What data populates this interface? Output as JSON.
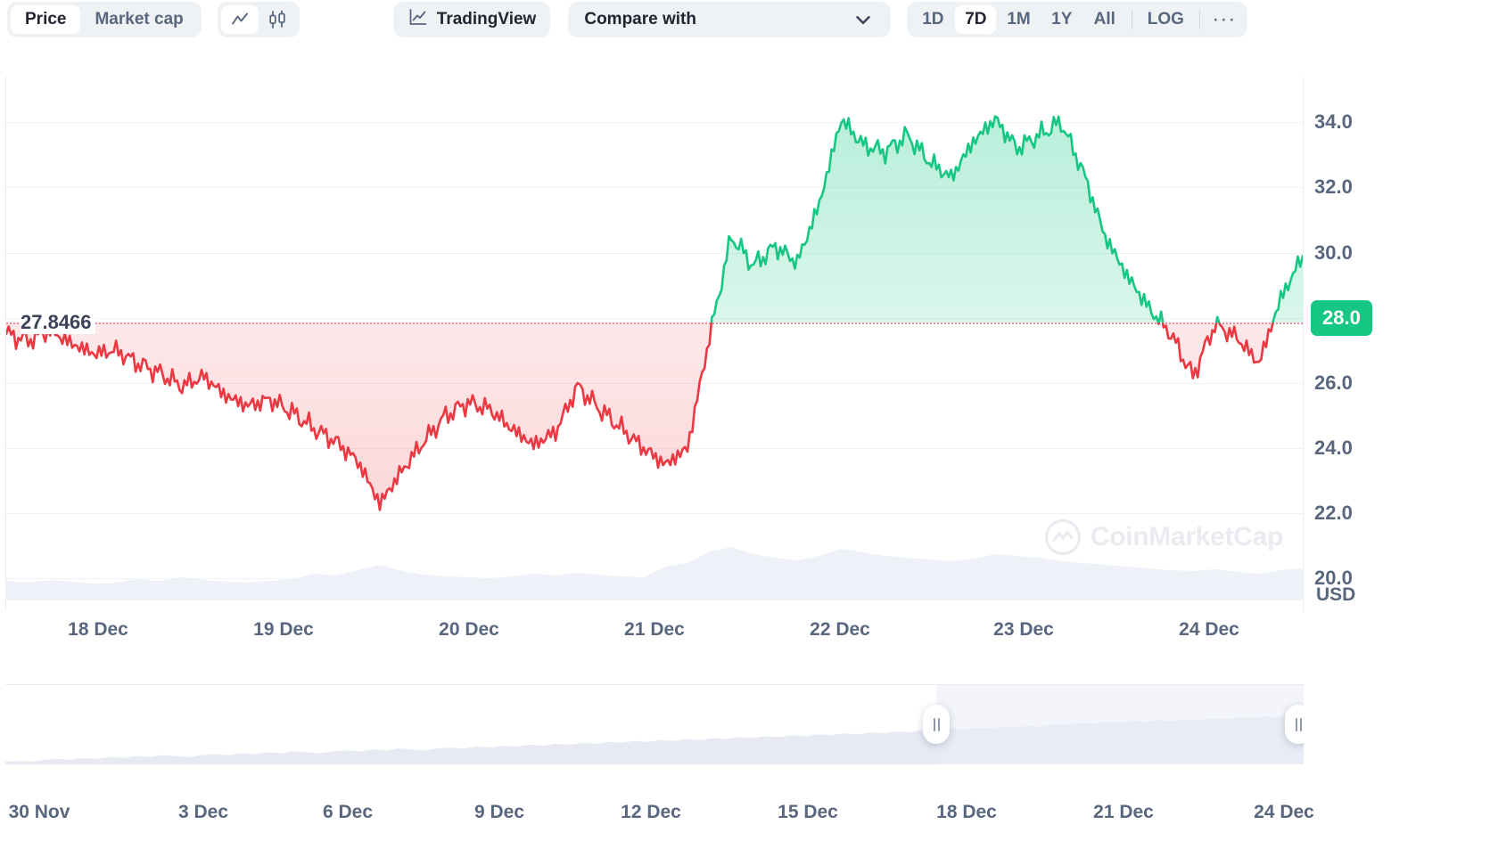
{
  "toolbar": {
    "metric_tabs": [
      {
        "label": "Price",
        "active": true
      },
      {
        "label": "Market cap",
        "active": false
      }
    ],
    "chart_type_icons": [
      {
        "name": "line-chart-icon",
        "active": true
      },
      {
        "name": "candlestick-chart-icon",
        "active": false
      }
    ],
    "tradingview_label": "TradingView",
    "compare_label": "Compare with",
    "range_buttons": [
      {
        "label": "1D",
        "active": false
      },
      {
        "label": "7D",
        "active": true
      },
      {
        "label": "1M",
        "active": false
      },
      {
        "label": "1Y",
        "active": false
      },
      {
        "label": "All",
        "active": false
      }
    ],
    "log_label": "LOG",
    "more_label": "···"
  },
  "chart_data": {
    "type": "area",
    "title": "",
    "xlabel": "",
    "ylabel": "USD",
    "currency_label": "USD",
    "ylim": [
      19.0,
      35.4
    ],
    "yticks": [
      "34.0",
      "32.0",
      "30.0",
      "28.0",
      "26.0",
      "24.0",
      "22.0",
      "20.0"
    ],
    "ytick_values": [
      34.0,
      32.0,
      30.0,
      28.0,
      26.0,
      24.0,
      22.0,
      20.0
    ],
    "current_price_label": "28.0",
    "current_price_value": 28.0,
    "reference_price_label": "27.8466",
    "reference_price_value": 27.8466,
    "grid": true,
    "legend": "none",
    "up_color": "#16c784",
    "down_color": "#ea3943",
    "xticks": [
      "18 Dec",
      "19 Dec",
      "20 Dec",
      "21 Dec",
      "22 Dec",
      "23 Dec",
      "24 Dec"
    ],
    "x": [
      "17 Dec 12:00",
      "17 Dec 14:00",
      "17 Dec 16:00",
      "17 Dec 18:00",
      "17 Dec 20:00",
      "17 Dec 22:00",
      "18 Dec 00:00",
      "18 Dec 03:00",
      "18 Dec 06:00",
      "18 Dec 09:00",
      "18 Dec 12:00",
      "18 Dec 15:00",
      "18 Dec 18:00",
      "18 Dec 21:00",
      "19 Dec 00:00",
      "19 Dec 03:00",
      "19 Dec 06:00",
      "19 Dec 09:00",
      "19 Dec 12:00",
      "19 Dec 15:00",
      "19 Dec 18:00",
      "19 Dec 21:00",
      "20 Dec 00:00",
      "20 Dec 03:00",
      "20 Dec 06:00",
      "20 Dec 09:00",
      "20 Dec 12:00",
      "20 Dec 15:00",
      "20 Dec 18:00",
      "20 Dec 21:00",
      "21 Dec 00:00",
      "21 Dec 03:00",
      "21 Dec 06:00",
      "21 Dec 09:00",
      "21 Dec 12:00",
      "21 Dec 15:00",
      "21 Dec 18:00",
      "21 Dec 21:00",
      "22 Dec 00:00",
      "22 Dec 03:00",
      "22 Dec 06:00",
      "22 Dec 09:00",
      "22 Dec 12:00",
      "22 Dec 15:00",
      "22 Dec 18:00",
      "22 Dec 21:00",
      "23 Dec 00:00",
      "23 Dec 03:00",
      "23 Dec 06:00",
      "23 Dec 09:00",
      "23 Dec 12:00",
      "23 Dec 15:00",
      "23 Dec 18:00",
      "23 Dec 21:00",
      "24 Dec 00:00",
      "24 Dec 03:00",
      "24 Dec 06:00",
      "24 Dec 09:00",
      "24 Dec 12:00",
      "24 Dec 18:00"
    ],
    "values": [
      27.5,
      27.3,
      27.6,
      27.2,
      26.9,
      27.0,
      26.6,
      26.3,
      25.9,
      26.2,
      25.6,
      25.3,
      25.5,
      25.1,
      24.6,
      24.2,
      23.6,
      22.3,
      23.3,
      24.2,
      25.0,
      25.4,
      25.2,
      24.6,
      24.1,
      24.5,
      25.9,
      25.2,
      24.6,
      24.0,
      23.5,
      24.0,
      27.4,
      30.5,
      29.6,
      30.2,
      29.7,
      31.5,
      34.1,
      33.3,
      33.1,
      33.6,
      32.8,
      32.3,
      33.4,
      34.1,
      33.2,
      33.6,
      34.0,
      32.5,
      30.5,
      29.3,
      28.3,
      27.5,
      26.2,
      27.8,
      27.4,
      26.6,
      28.6,
      29.9
    ],
    "series": [
      {
        "name": "Price (below reference)",
        "color": "#ea3943",
        "fill": "rgba(234,57,67,0.12)"
      },
      {
        "name": "Price (above reference)",
        "color": "#16c784",
        "fill": "rgba(22,199,132,0.16)"
      }
    ],
    "volume": {
      "label": "Volume",
      "color": "#eff2f7",
      "values": [
        22,
        20,
        23,
        21,
        19,
        20,
        24,
        22,
        26,
        23,
        21,
        20,
        22,
        24,
        30,
        28,
        34,
        40,
        33,
        29,
        27,
        26,
        25,
        27,
        30,
        28,
        31,
        29,
        27,
        26,
        38,
        42,
        55,
        60,
        52,
        48,
        45,
        50,
        58,
        54,
        50,
        48,
        46,
        44,
        47,
        52,
        50,
        48,
        44,
        42,
        40,
        38,
        36,
        34,
        33,
        35,
        32,
        30,
        34,
        36
      ]
    }
  },
  "watermark": {
    "text": "CoinMarketCap",
    "logo_name": "coinmarketcap-logo-icon"
  },
  "navigator": {
    "xticks": [
      "30 Nov",
      "3 Dec",
      "6 Dec",
      "9 Dec",
      "12 Dec",
      "15 Dec",
      "18 Dec",
      "21 Dec",
      "24 Dec"
    ],
    "selection_start_label": "18 Dec",
    "selection_end_label": "24 Dec",
    "left_handle_name": "navigator-left-handle",
    "right_handle_name": "navigator-right-handle",
    "series_values": [
      18,
      19,
      18,
      20,
      21,
      20,
      22,
      21,
      23,
      22,
      24,
      23,
      25,
      24,
      23,
      25,
      26,
      25,
      27,
      26,
      28,
      27,
      29,
      28,
      27,
      29,
      30,
      29,
      31,
      30,
      32,
      31,
      30,
      32,
      33,
      32,
      34,
      33,
      35,
      34,
      36,
      35,
      37,
      36,
      38,
      37,
      39,
      38,
      40,
      39,
      41,
      40,
      42,
      41,
      43,
      42,
      44,
      43,
      45,
      44,
      46,
      45,
      47,
      46,
      48,
      47,
      49,
      48,
      50,
      49,
      52,
      51,
      53,
      52,
      54,
      53,
      55,
      54,
      56,
      55,
      58,
      57,
      59,
      58,
      60,
      59,
      61,
      60,
      62,
      61,
      63,
      62,
      64,
      63,
      65,
      64,
      66,
      65,
      67,
      66
    ]
  }
}
